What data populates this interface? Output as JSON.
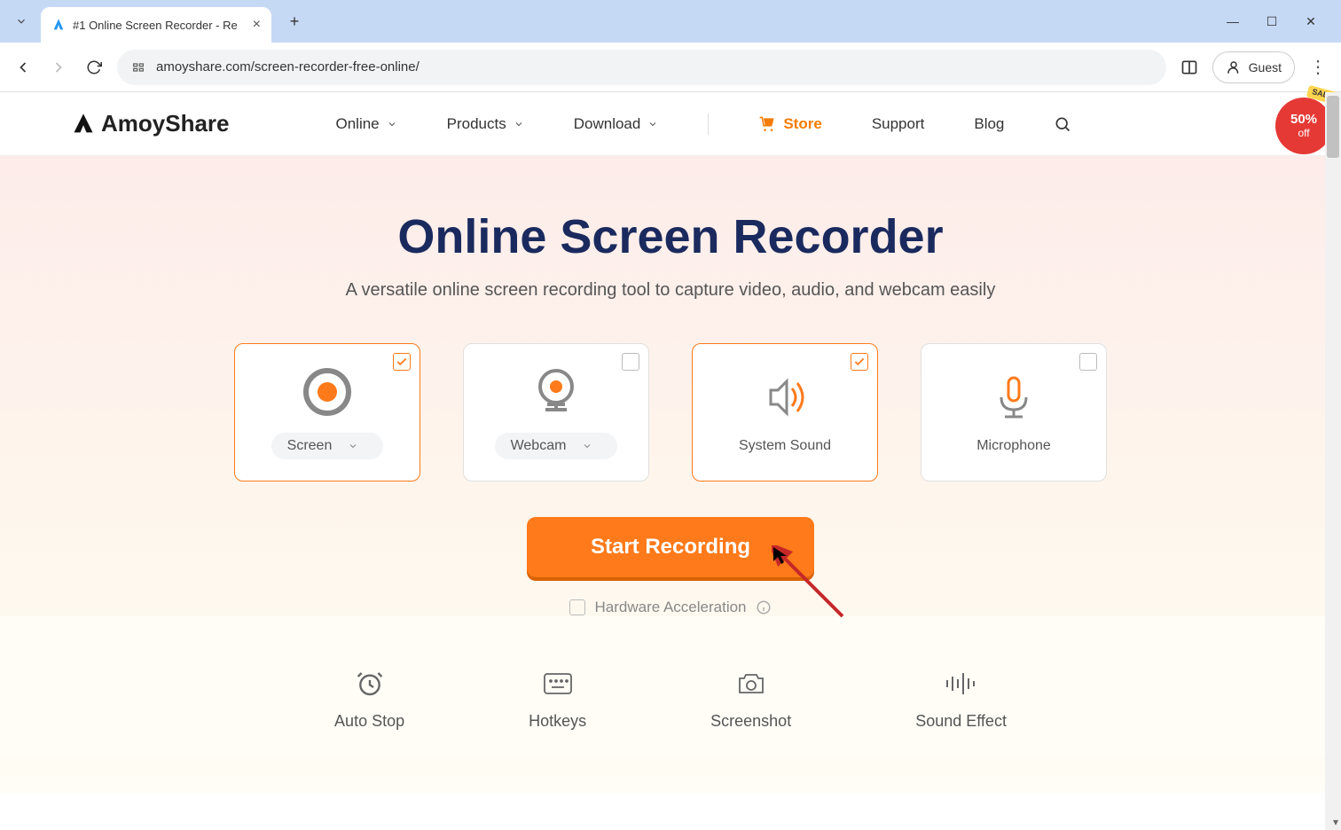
{
  "browser": {
    "tab_title": "#1 Online Screen Recorder - Re",
    "url": "amoyshare.com/screen-recorder-free-online/",
    "guest_label": "Guest"
  },
  "header": {
    "brand": "AmoyShare",
    "nav": {
      "online": "Online",
      "products": "Products",
      "download": "Download",
      "store": "Store",
      "support": "Support",
      "blog": "Blog"
    },
    "sale": {
      "tag": "SALE",
      "line1": "50%",
      "line2": "off"
    }
  },
  "hero": {
    "title": "Online Screen Recorder",
    "subtitle": "A versatile online screen recording tool to capture video, audio, and webcam easily",
    "cards": {
      "screen": "Screen",
      "webcam": "Webcam",
      "system_sound": "System Sound",
      "microphone": "Microphone"
    },
    "start_btn": "Start Recording",
    "hardware": "Hardware Acceleration"
  },
  "features": {
    "auto_stop": "Auto Stop",
    "hotkeys": "Hotkeys",
    "screenshot": "Screenshot",
    "sound_effect": "Sound Effect"
  }
}
